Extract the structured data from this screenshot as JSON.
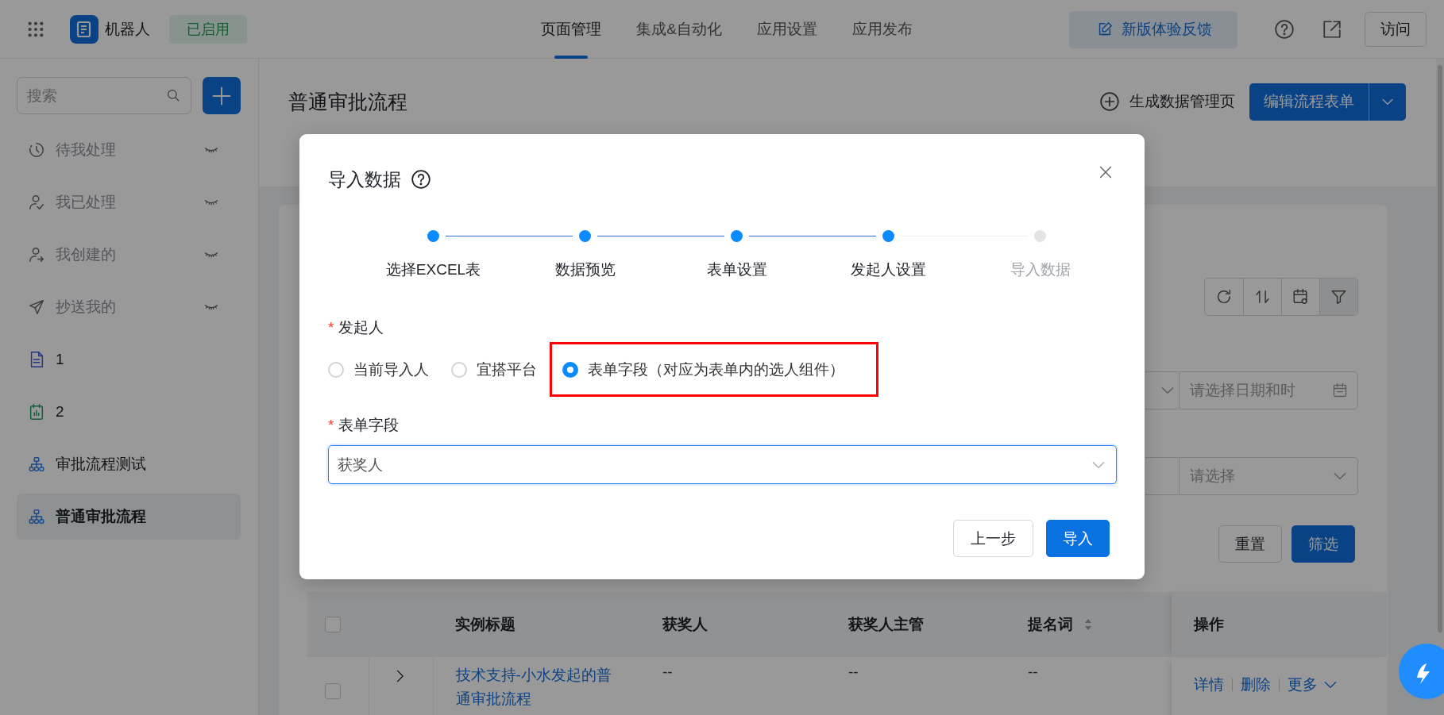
{
  "topbar": {
    "app_name": "机器人",
    "status_badge": "已启用",
    "nav_tabs": [
      {
        "label": "页面管理",
        "selected": true
      },
      {
        "label": "集成&自动化",
        "selected": false
      },
      {
        "label": "应用设置",
        "selected": false
      },
      {
        "label": "应用发布",
        "selected": false
      }
    ],
    "feedback_button": "新版体验反馈",
    "visit_button": "访问"
  },
  "sidebar": {
    "search": {
      "placeholder": "搜索"
    },
    "items": [
      {
        "label": "待我处理",
        "kind": "todo",
        "hidden": true,
        "selected": false
      },
      {
        "label": "我已处理",
        "kind": "done",
        "hidden": true,
        "selected": false
      },
      {
        "label": "我创建的",
        "kind": "created",
        "hidden": true,
        "selected": false
      },
      {
        "label": "抄送我的",
        "kind": "cc",
        "hidden": true,
        "selected": false
      },
      {
        "label": "1",
        "kind": "form",
        "hidden": false,
        "selected": false
      },
      {
        "label": "2",
        "kind": "report",
        "hidden": false,
        "selected": false
      },
      {
        "label": "审批流程测试",
        "kind": "flow",
        "hidden": false,
        "selected": false
      },
      {
        "label": "普通审批流程",
        "kind": "flow",
        "hidden": false,
        "selected": true
      }
    ]
  },
  "main": {
    "title": "普通审批流程",
    "generate_button": "生成数据管理页",
    "edit_button": "编辑流程表单",
    "filters": [
      {
        "placeholder": "请选择日期和时",
        "kind": "datetime"
      },
      {
        "placeholder": "请选择",
        "kind": "select"
      }
    ],
    "reset_button": "重置",
    "filter_button": "筛选",
    "table": {
      "all_selected": false,
      "columns": [
        {
          "label": "实例标题",
          "sortable": false
        },
        {
          "label": "获奖人",
          "sortable": false
        },
        {
          "label": "获奖人主管",
          "sortable": false
        },
        {
          "label": "提名词",
          "sortable": true
        },
        {
          "label": "操作",
          "sortable": false
        }
      ],
      "rows": [
        {
          "selected": false,
          "expanded": false,
          "cells": [
            "技术支持-小水发起的普通审批流程",
            "--",
            "--",
            "--"
          ],
          "actions": [
            "详情",
            "删除",
            "更多"
          ]
        }
      ]
    }
  },
  "dialog": {
    "title": "导入数据",
    "steps": [
      {
        "label": "选择EXCEL表",
        "done": true
      },
      {
        "label": "数据预览",
        "done": true
      },
      {
        "label": "表单设置",
        "done": true
      },
      {
        "label": "发起人设置",
        "done": true
      },
      {
        "label": "导入数据",
        "done": false
      }
    ],
    "initiator": {
      "label": "发起人",
      "required": true,
      "required_mark": "*",
      "options": [
        {
          "label": "当前导入人",
          "selected": false,
          "highlighted": false
        },
        {
          "label": "宜搭平台",
          "selected": false,
          "highlighted": false
        },
        {
          "label": "表单字段（对应为表单内的选人组件）",
          "selected": true,
          "highlighted": true
        }
      ]
    },
    "form_field": {
      "label": "表单字段",
      "required": true,
      "required_mark": "*",
      "value": "获奖人"
    },
    "back_button": "上一步",
    "import_button": "导入"
  }
}
